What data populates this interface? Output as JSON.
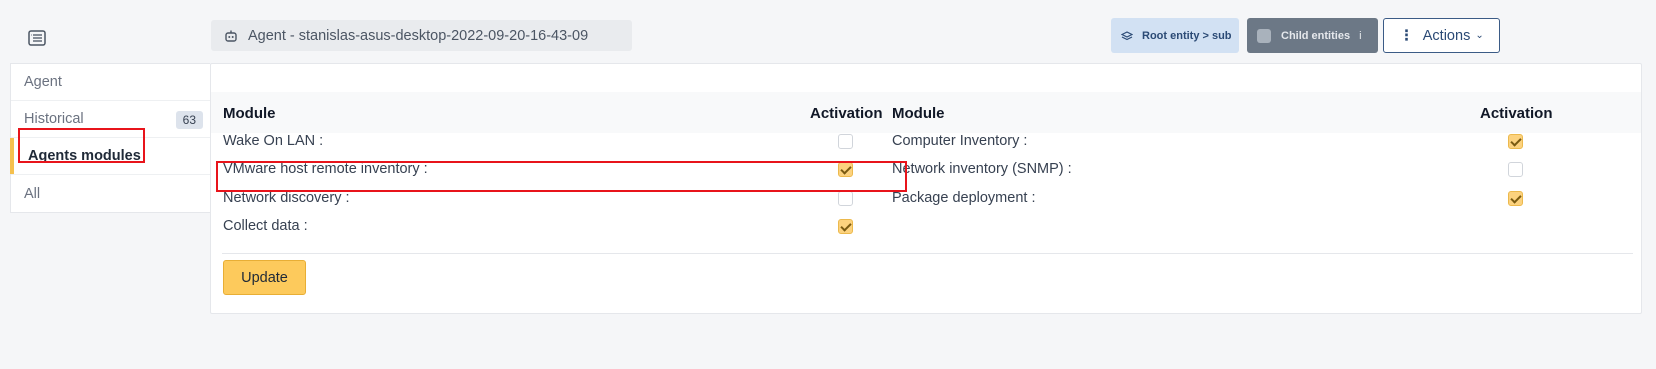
{
  "header": {
    "title": "Agent - stanislas-asus-desktop-2022-09-20-16-43-09",
    "entity_label": "Root entity > sub",
    "child_entities_label": "Child entities",
    "child_info": "i",
    "actions_label": "Actions"
  },
  "sidebar": {
    "items": [
      {
        "label": "Agent"
      },
      {
        "label": "Historical",
        "badge": "63"
      },
      {
        "label": "Agents modules"
      },
      {
        "label": "All"
      }
    ]
  },
  "table": {
    "col_module": "Module",
    "col_activation": "Activation",
    "left": [
      {
        "label": "Wake On LAN :",
        "checked": false
      },
      {
        "label": "VMware host remote inventory :",
        "checked": true
      },
      {
        "label": "Network discovery :",
        "checked": false
      },
      {
        "label": "Collect data :",
        "checked": true
      }
    ],
    "right": [
      {
        "label": "Computer Inventory :",
        "checked": true
      },
      {
        "label": "Network inventory (SNMP) :",
        "checked": false
      },
      {
        "label": "Package deployment :",
        "checked": true
      }
    ]
  },
  "update_label": "Update",
  "colors": {
    "accent": "#fdca5c",
    "highlight": "#e8141b",
    "badge_bg": "#dde3ec"
  }
}
